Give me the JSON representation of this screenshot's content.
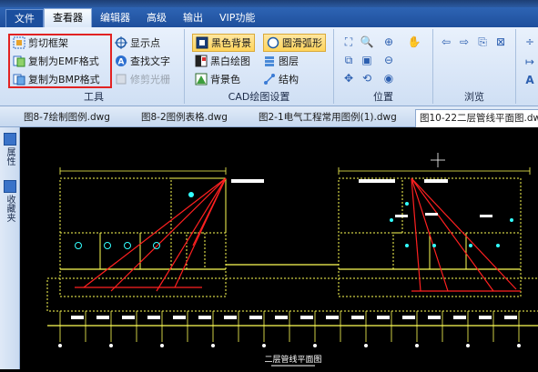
{
  "menu": {
    "file": "文件",
    "items": [
      "查看器",
      "编辑器",
      "高级",
      "输出",
      "VIP功能"
    ]
  },
  "ribbon": {
    "tools": {
      "label": "工具",
      "cut_frame": "剪切框架",
      "copy_emf": "复制为EMF格式",
      "copy_bmp": "复制为BMP格式",
      "show_point": "显示点",
      "find_text": "查找文字",
      "trim_raster": "修剪光栅"
    },
    "cad": {
      "label": "CAD绘图设置",
      "black_bg": "黑色背景",
      "smooth_arc": "圆滑弧形",
      "bw_drawing": "黑白绘图",
      "layers": "图层",
      "bg_color": "背景色",
      "structure": "结构"
    },
    "position": {
      "label": "位置"
    },
    "browse": {
      "label": "浏览"
    }
  },
  "doc_tabs": [
    "图8-7绘制图例.dwg",
    "图8-2图例表格.dwg",
    "图2-1电气工程常用图例(1).dwg",
    "图10-22二层管线平面图.dw"
  ],
  "side_panel": {
    "properties": "属性",
    "favorites": "收藏夹"
  },
  "drawing": {
    "caption": "二层管线平面图"
  },
  "colors": {
    "accent_blue": "#1e4f9c",
    "highlight_red": "#e22222",
    "cad_yellow": "#ffff55",
    "cad_red": "#ff2020",
    "cad_cyan": "#33ffff"
  }
}
